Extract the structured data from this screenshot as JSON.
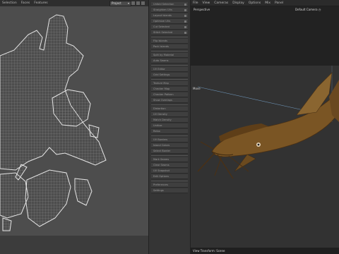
{
  "uv_menu": [
    "Selection",
    "Faces",
    "Features"
  ],
  "uv_dropdown": "Project",
  "side_panel_items": [
    "Unfold Selection",
    "Straighten UVs",
    "Layout Islands",
    "Optimize UVs",
    "Cut Selected",
    "Stitch Selected",
    "Flip Islands",
    "Pack Islands",
    "Split by Material",
    "Auto Seams",
    "UV Editor",
    "Grid Settings",
    "Texture Map",
    "Checker Map",
    "Checker Pattern",
    "Show Overlaps",
    "Distortion",
    "UV Density",
    "Match Density",
    "Unitize",
    "Relax",
    "UV Borders",
    "Island Colors",
    "Select Border",
    "Mark Seams",
    "Clear Seams",
    "UV Snapshot",
    "Edit Options",
    "Preferences",
    "Settings"
  ],
  "viewport_menu": [
    "File",
    "View",
    "Cameras",
    "Display",
    "Options",
    "Mix",
    "Panel"
  ],
  "viewport_label": "Perspective",
  "camera_label": "Default Camera",
  "gizmo_label": "Move",
  "status_text": "View Transform: Scene",
  "colors": {
    "uv_background": "#4d4d4d",
    "uv_wire": "#dcdcdc",
    "viewport_background": "#323232",
    "fish_body": "#7a5524"
  },
  "icons": [
    "chevron-down-icon",
    "camera-icon",
    "axis-gizmo-icon"
  ]
}
